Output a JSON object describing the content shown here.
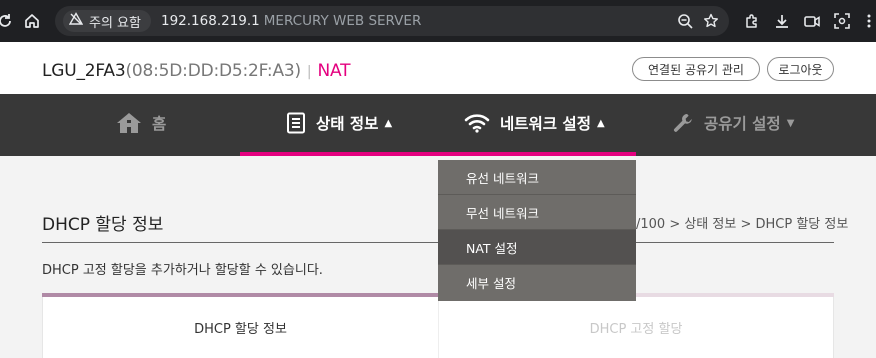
{
  "browser": {
    "security_label": "주의 요함",
    "url_host": "192.168.219.1",
    "url_title": "MERCURY WEB SERVER",
    "icons": [
      "refresh-icon",
      "home-icon",
      "warning-icon",
      "zoom-icon",
      "bookmark-star-icon",
      "extensions-icon",
      "download-icon",
      "screen-record-icon",
      "screenshot-icon",
      "menu-dots-icon"
    ]
  },
  "header": {
    "device_name": "LGU_2FA3",
    "mac": "(08:5D:DD:D5:2F:A3)",
    "separator": "|",
    "mode": "NAT",
    "manage_button": "연결된 공유기 관리",
    "logout_button": "로그아웃"
  },
  "nav": {
    "home": "홈",
    "status": "상태 정보",
    "network": "네트워크 설정",
    "router": "공유기 설정",
    "caret_up": "▲",
    "caret_down": "▼"
  },
  "dropdown": {
    "items": [
      "유선 네트워크",
      "무선 네트워크",
      "NAT 설정",
      "세부 설정"
    ],
    "active_index": 2
  },
  "page": {
    "title": "DHCP 할당 정보",
    "breadcrumb": "/100 > 상태 정보 > DHCP 할당 정보",
    "description": "DHCP 고정 할당을 추가하거나 할당할 수 있습니다.",
    "tabs": [
      "DHCP 할당 정보",
      "DHCP 고정 할당"
    ]
  },
  "colors": {
    "accent": "#e4007f",
    "nav_bg": "#383838",
    "dropdown_bg": "#6f6d6a",
    "dropdown_active": "#535150",
    "tab_active_bar": "#b08aa6",
    "tab_inactive_bar": "#e8dbe3"
  }
}
